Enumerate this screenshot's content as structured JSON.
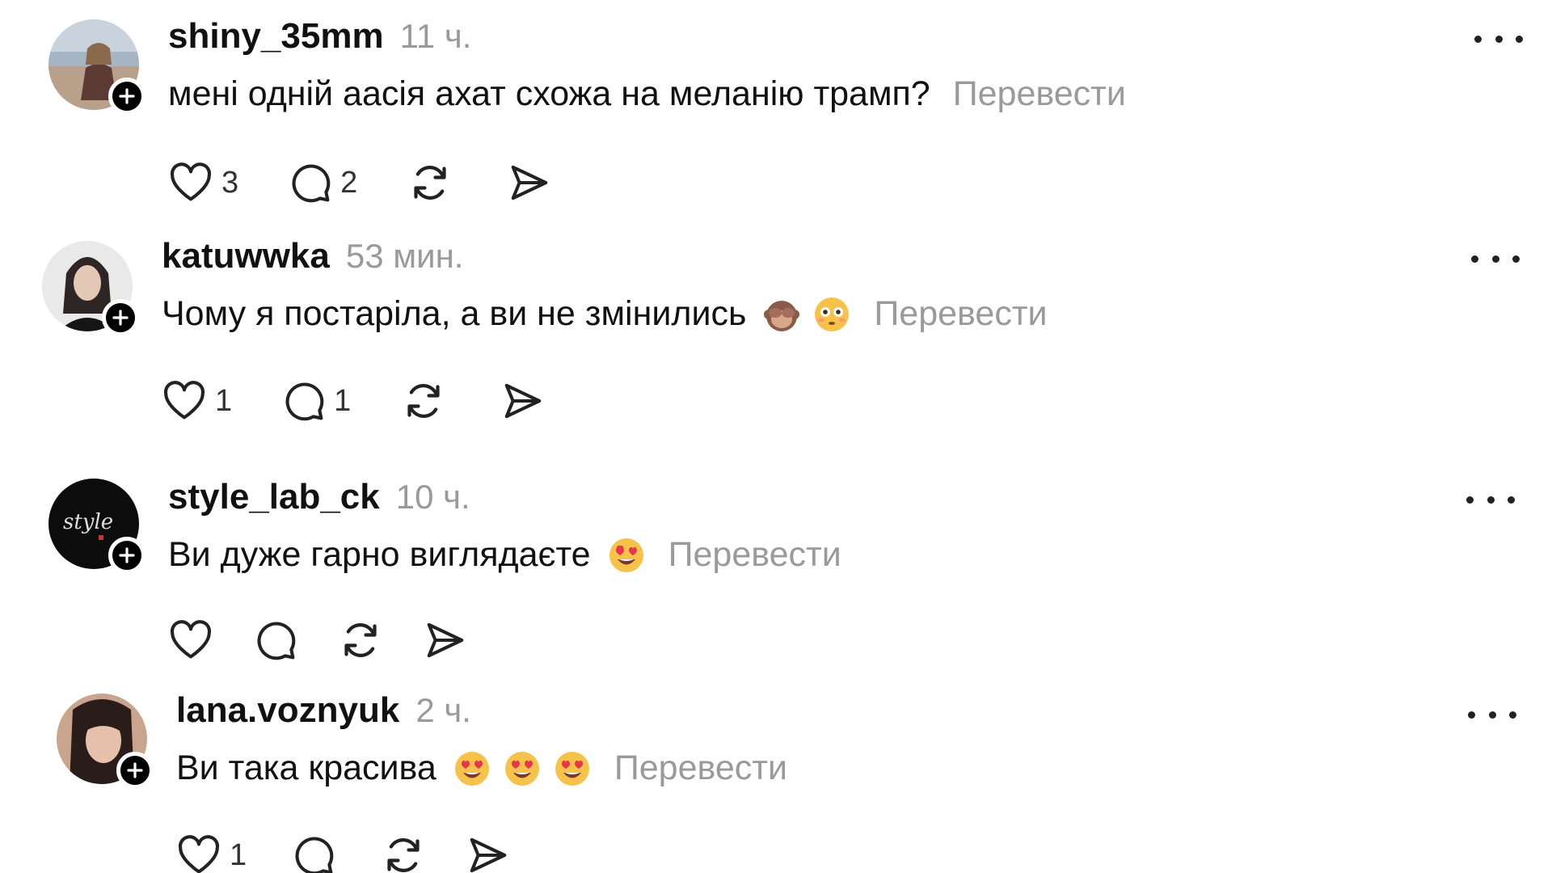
{
  "ui": {
    "translate_label": "Перевести"
  },
  "posts": [
    {
      "username": "shiny_35mm",
      "time": "11 ч.",
      "text": "мені одній аасія ахат схожа на меланію трамп?",
      "likes": "3",
      "replies": "2",
      "emojis": []
    },
    {
      "username": "katuwwka",
      "time": "53 мин.",
      "text": "Чому я постаріла, а ви не змінились",
      "likes": "1",
      "replies": "1",
      "emojis": [
        "see-no-evil-monkey-icon",
        "flushed-face-icon"
      ]
    },
    {
      "username": "style_lab_ck",
      "time": "10 ч.",
      "text": "Ви дуже гарно виглядаєте",
      "likes": "",
      "replies": "",
      "emojis": [
        "heart-eyes-icon"
      ],
      "avatar_text": "style"
    },
    {
      "username": "lana.voznyuk",
      "time": "2 ч.",
      "text": "Ви така красива",
      "likes": "1",
      "replies": "",
      "emojis": [
        "heart-eyes-icon",
        "heart-eyes-icon",
        "heart-eyes-icon"
      ]
    }
  ],
  "colors": {
    "secondary_text": "#9a9a9a",
    "primary_text": "#111111",
    "badge": "#000000"
  }
}
